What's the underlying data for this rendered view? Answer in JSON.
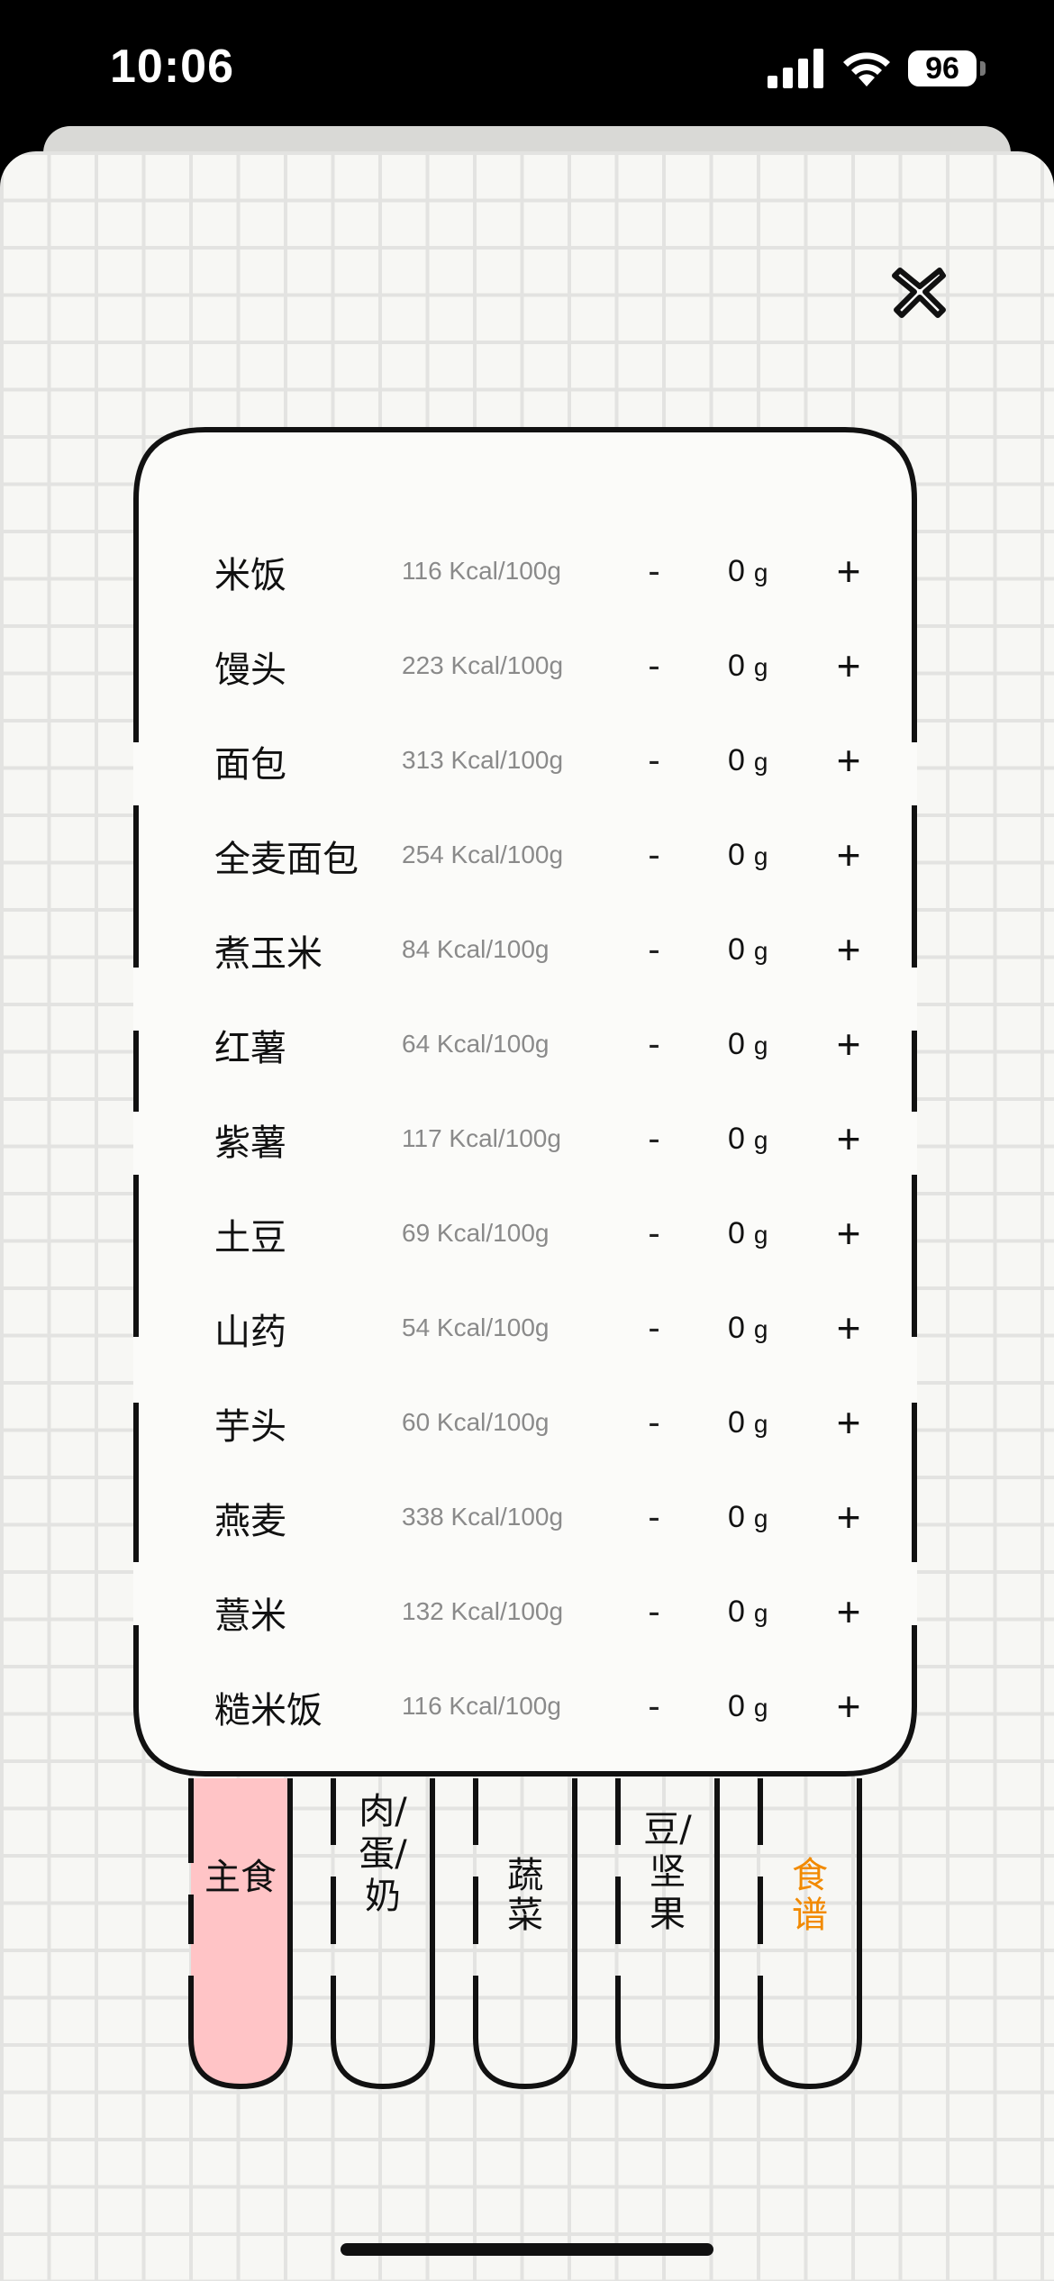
{
  "status_bar": {
    "time": "10:06",
    "battery": "96"
  },
  "colors": {
    "active_tab_fill": "#ffc4c6",
    "recipe_tab_text": "#f28a00",
    "grid_line": "#e3e3e1",
    "background": "#f7f7f4"
  },
  "foods": [
    {
      "name": "米饭",
      "kcal": "116 Kcal/100g",
      "minus": "-",
      "qty": "0",
      "unit": "g",
      "plus": "+"
    },
    {
      "name": "馒头",
      "kcal": "223 Kcal/100g",
      "minus": "-",
      "qty": "0",
      "unit": "g",
      "plus": "+"
    },
    {
      "name": "面包",
      "kcal": "313 Kcal/100g",
      "minus": "-",
      "qty": "0",
      "unit": "g",
      "plus": "+"
    },
    {
      "name": "全麦面包",
      "kcal": "254 Kcal/100g",
      "minus": "-",
      "qty": "0",
      "unit": "g",
      "plus": "+"
    },
    {
      "name": "煮玉米",
      "kcal": "84 Kcal/100g",
      "minus": "-",
      "qty": "0",
      "unit": "g",
      "plus": "+"
    },
    {
      "name": "红薯",
      "kcal": "64 Kcal/100g",
      "minus": "-",
      "qty": "0",
      "unit": "g",
      "plus": "+"
    },
    {
      "name": "紫薯",
      "kcal": "117 Kcal/100g",
      "minus": "-",
      "qty": "0",
      "unit": "g",
      "plus": "+"
    },
    {
      "name": "土豆",
      "kcal": "69 Kcal/100g",
      "minus": "-",
      "qty": "0",
      "unit": "g",
      "plus": "+"
    },
    {
      "name": "山药",
      "kcal": "54 Kcal/100g",
      "minus": "-",
      "qty": "0",
      "unit": "g",
      "plus": "+"
    },
    {
      "name": "芋头",
      "kcal": "60 Kcal/100g",
      "minus": "-",
      "qty": "0",
      "unit": "g",
      "plus": "+"
    },
    {
      "name": "燕麦",
      "kcal": "338 Kcal/100g",
      "minus": "-",
      "qty": "0",
      "unit": "g",
      "plus": "+"
    },
    {
      "name": "薏米",
      "kcal": "132 Kcal/100g",
      "minus": "-",
      "qty": "0",
      "unit": "g",
      "plus": "+"
    },
    {
      "name": "糙米饭",
      "kcal": "116 Kcal/100g",
      "minus": "-",
      "qty": "0",
      "unit": "g",
      "plus": "+"
    }
  ],
  "tabs": [
    {
      "label": "主食",
      "active": true
    },
    {
      "label": "肉/蛋/奶",
      "active": false
    },
    {
      "label": "蔬菜",
      "active": false
    },
    {
      "label": "豆/坚果",
      "active": false
    },
    {
      "label": "食谱",
      "active": false
    }
  ]
}
